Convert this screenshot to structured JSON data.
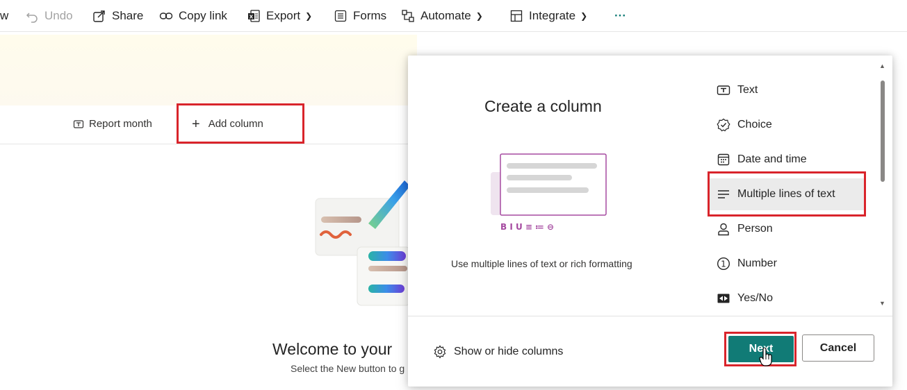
{
  "toolbar": {
    "partial_label": "w",
    "undo_label": "Undo",
    "share_label": "Share",
    "copy_link_label": "Copy link",
    "export_label": "Export",
    "forms_label": "Forms",
    "automate_label": "Automate",
    "integrate_label": "Integrate",
    "more_label": "···"
  },
  "columns": {
    "report_month": "Report month",
    "add_column": "Add column"
  },
  "empty_state": {
    "title": "Welcome to your",
    "subtitle": "Select the New button to g"
  },
  "panel": {
    "title": "Create a column",
    "description": "Use multiple lines of text or rich formatting",
    "preview_toolbar": "B I U ≡ ≔ ⊖",
    "types": [
      {
        "label": "Text",
        "icon": "text-icon"
      },
      {
        "label": "Choice",
        "icon": "choice-icon"
      },
      {
        "label": "Date and time",
        "icon": "calendar-icon"
      },
      {
        "label": "Multiple lines of text",
        "icon": "multiline-icon",
        "selected": true
      },
      {
        "label": "Person",
        "icon": "person-icon"
      },
      {
        "label": "Number",
        "icon": "number-icon"
      },
      {
        "label": "Yes/No",
        "icon": "yes-no-icon"
      }
    ],
    "show_hide_label": "Show or hide columns",
    "next_label": "Next",
    "cancel_label": "Cancel"
  },
  "colors": {
    "accent": "#117b76",
    "highlight_border": "#d9242b"
  }
}
